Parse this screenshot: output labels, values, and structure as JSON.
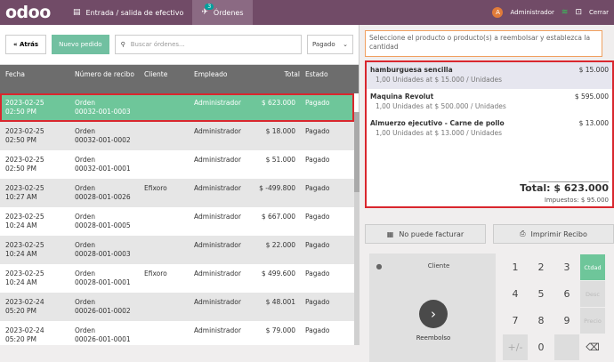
{
  "topbar": {
    "logo": "odoo",
    "cash_label": "Entrada / salida de efectivo",
    "orders_label": "Órdenes",
    "orders_badge": "3",
    "user_initial": "A",
    "user_name": "Administrador",
    "close_label": "Cerrar"
  },
  "controls": {
    "back_label": "« Atrás",
    "new_order_label": "Nuevo pedido",
    "search_placeholder": "Buscar órdenes...",
    "filter_value": "Pagado"
  },
  "table": {
    "headers": {
      "fecha": "Fecha",
      "numero": "Número de recibo",
      "cliente": "Cliente",
      "empleado": "Empleado",
      "total": "Total",
      "estado": "Estado"
    },
    "rows": [
      {
        "date": "2023-02-25",
        "time": "02:50 PM",
        "order": "Orden",
        "num": "00032-001-0003",
        "cliente": "",
        "empleado": "Administrador",
        "total": "$ 623.000",
        "estado": "Pagado"
      },
      {
        "date": "2023-02-25",
        "time": "02:50 PM",
        "order": "Orden",
        "num": "00032-001-0002",
        "cliente": "",
        "empleado": "Administrador",
        "total": "$ 18.000",
        "estado": "Pagado"
      },
      {
        "date": "2023-02-25",
        "time": "02:50 PM",
        "order": "Orden",
        "num": "00032-001-0001",
        "cliente": "",
        "empleado": "Administrador",
        "total": "$ 51.000",
        "estado": "Pagado"
      },
      {
        "date": "2023-02-25",
        "time": "10:27 AM",
        "order": "Orden",
        "num": "00028-001-0026",
        "cliente": "Efixoro",
        "empleado": "Administrador",
        "total": "$ -499.800",
        "estado": "Pagado"
      },
      {
        "date": "2023-02-25",
        "time": "10:24 AM",
        "order": "Orden",
        "num": "00028-001-0005",
        "cliente": "",
        "empleado": "Administrador",
        "total": "$ 667.000",
        "estado": "Pagado"
      },
      {
        "date": "2023-02-25",
        "time": "10:24 AM",
        "order": "Orden",
        "num": "00028-001-0003",
        "cliente": "",
        "empleado": "Administrador",
        "total": "$ 22.000",
        "estado": "Pagado"
      },
      {
        "date": "2023-02-25",
        "time": "10:24 AM",
        "order": "Orden",
        "num": "00028-001-0001",
        "cliente": "Efixoro",
        "empleado": "Administrador",
        "total": "$ 499.600",
        "estado": "Pagado"
      },
      {
        "date": "2023-02-24",
        "time": "05:20 PM",
        "order": "Orden",
        "num": "00026-001-0002",
        "cliente": "",
        "empleado": "Administrador",
        "total": "$ 48.001",
        "estado": "Pagado"
      },
      {
        "date": "2023-02-24",
        "time": "05:20 PM",
        "order": "Orden",
        "num": "00026-001-0001",
        "cliente": "",
        "empleado": "Administrador",
        "total": "$ 79.000",
        "estado": "Pagado"
      }
    ]
  },
  "right": {
    "info": "Seleccione el producto o producto(s) a reembolsar y establezca la cantidad",
    "lines": [
      {
        "name": "hamburguesa sencilla",
        "price": "$ 15.000",
        "detail": "1,00 Unidades at $ 15.000 / Unidades"
      },
      {
        "name": "Maquina Revolut",
        "price": "$ 595.000",
        "detail": "1,00 Unidades at $ 500.000 / Unidades"
      },
      {
        "name": "Almuerzo ejecutivo - Carne de pollo",
        "price": "$ 13.000",
        "detail": "1,00 Unidades at $ 13.000 / Unidades"
      }
    ],
    "total": "Total: $ 623.000",
    "taxes": "Impuestos: $ 95.000",
    "invoice_label": "No puede facturar",
    "print_label": "Imprimir Recibo",
    "customer_label": "Cliente",
    "refund_label": "Reembolso",
    "keys": {
      "k1": "1",
      "k2": "2",
      "k3": "3",
      "k4": "4",
      "k5": "5",
      "k6": "6",
      "k7": "7",
      "k8": "8",
      "k9": "9",
      "kpm": "+/-",
      "k0": "0",
      "kdel": "⌫"
    },
    "modes": {
      "qty": "Ctdad",
      "disc": "Desc",
      "price": "Precio"
    }
  },
  "colors": {
    "brand": "#714b67",
    "selected": "#6ec69a",
    "highlight": "#d9272e"
  }
}
